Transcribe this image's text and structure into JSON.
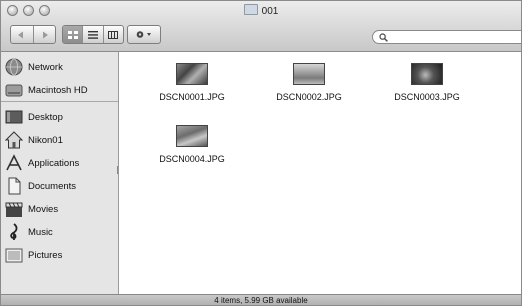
{
  "window": {
    "title": "001"
  },
  "toolbar": {
    "back_icon": "back-arrow-icon",
    "forward_icon": "forward-arrow-icon",
    "views": [
      "icon-view",
      "list-view",
      "column-view"
    ],
    "action_icon": "gear-icon",
    "search": {
      "value": "",
      "placeholder": ""
    }
  },
  "sidebar": {
    "devices": [
      {
        "label": "Network",
        "icon": "globe-icon"
      },
      {
        "label": "Macintosh HD",
        "icon": "hard-drive-icon"
      }
    ],
    "places": [
      {
        "label": "Desktop",
        "icon": "desktop-icon"
      },
      {
        "label": "Nikon01",
        "icon": "home-icon"
      },
      {
        "label": "Applications",
        "icon": "applications-icon"
      },
      {
        "label": "Documents",
        "icon": "documents-icon"
      },
      {
        "label": "Movies",
        "icon": "clapperboard-icon"
      },
      {
        "label": "Music",
        "icon": "music-note-icon"
      },
      {
        "label": "Pictures",
        "icon": "picture-frame-icon"
      }
    ]
  },
  "files": [
    {
      "name": "DSCN0001.JPG"
    },
    {
      "name": "DSCN0002.JPG"
    },
    {
      "name": "DSCN0003.JPG"
    },
    {
      "name": "DSCN0004.JPG"
    }
  ],
  "status": {
    "text": "4 items, 5.99 GB available"
  }
}
